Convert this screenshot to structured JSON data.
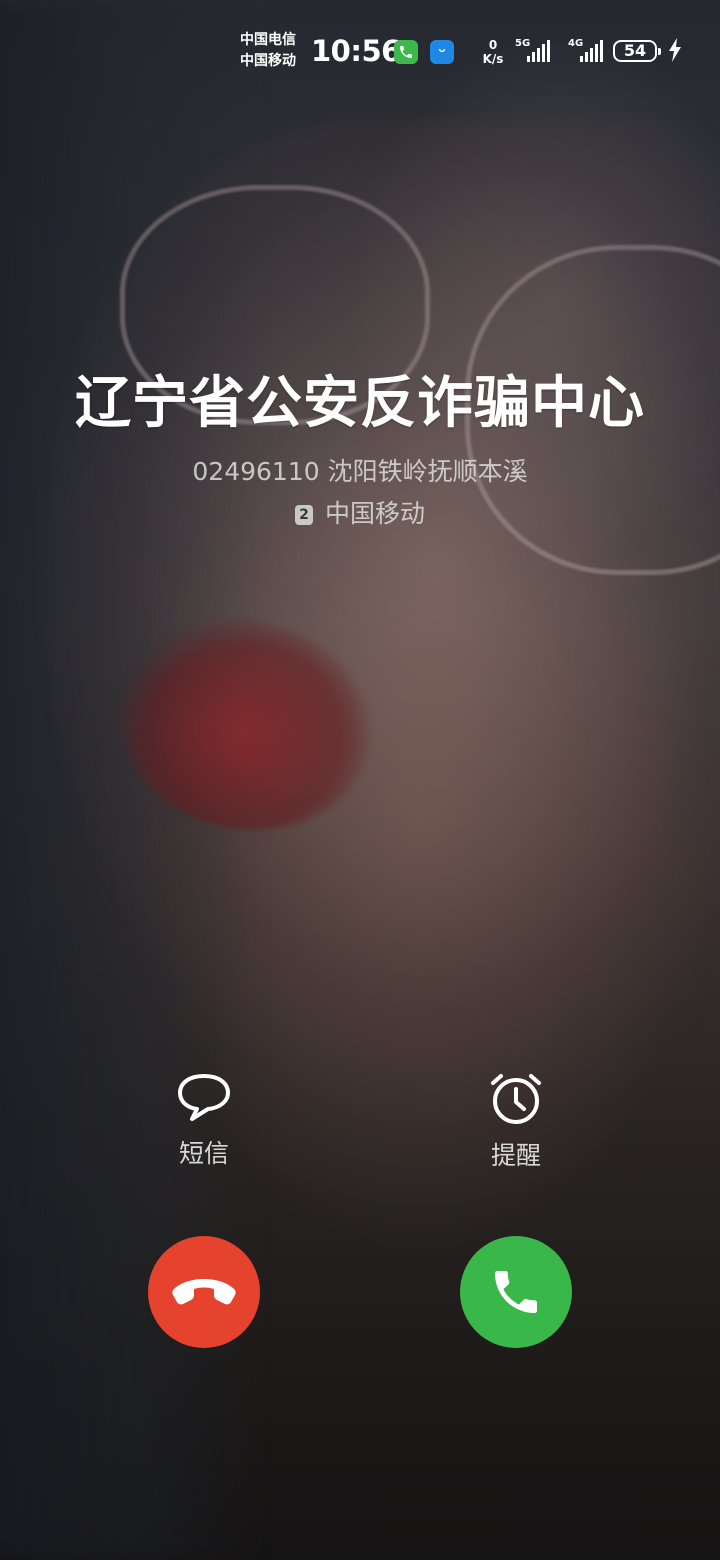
{
  "status_bar": {
    "carrier_1": "中国电信",
    "carrier_2": "中国移动",
    "time": "10:56",
    "net_speed_value": "0",
    "net_speed_unit": "K/s",
    "signal_1_type": "5G",
    "signal_2_type": "4G",
    "battery_level": "54",
    "app_icons": [
      "phone-app-icon",
      "shopping-bag-app-icon"
    ],
    "charging_icon": "lightning-bolt-icon"
  },
  "caller": {
    "name": "辽宁省公安反诈骗中心",
    "number_location": "02496110 沈阳铁岭抚顺本溪",
    "sim_slot": "2",
    "carrier": "中国移动"
  },
  "actions": {
    "message_label": "短信",
    "message_icon": "speech-bubble-icon",
    "reminder_label": "提醒",
    "reminder_icon": "alarm-clock-icon"
  },
  "buttons": {
    "decline_icon": "hang-up-phone-icon",
    "decline_color": "#e5432d",
    "answer_icon": "phone-icon",
    "answer_color": "#3ab749"
  }
}
